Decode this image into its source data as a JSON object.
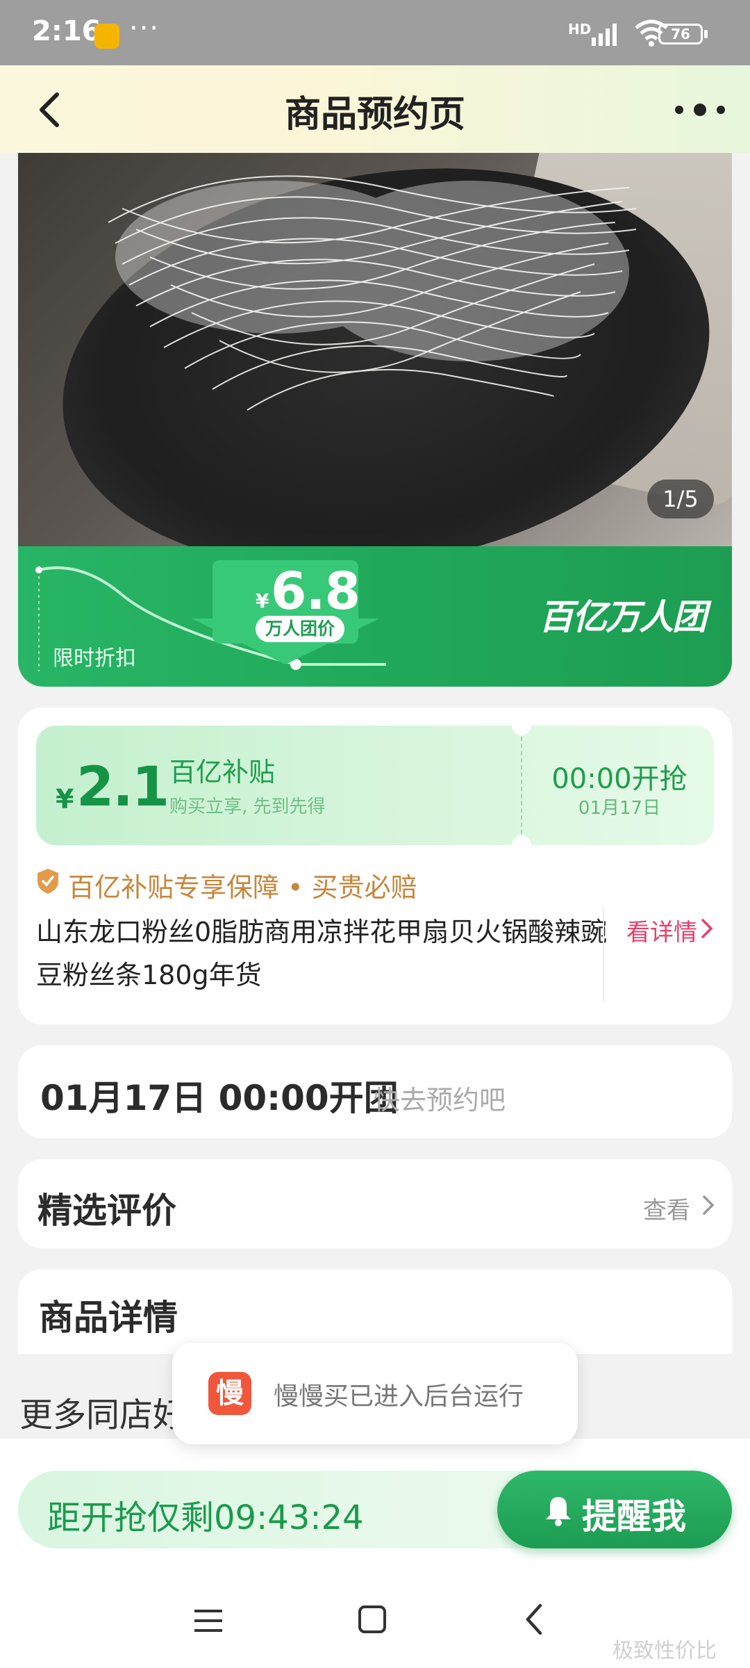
{
  "status_bar": {
    "time": "2:16",
    "more": "···",
    "network": "HD",
    "battery": "76"
  },
  "header": {
    "title": "商品预约页"
  },
  "hero": {
    "image_counter": "1/5"
  },
  "price_band": {
    "currency": "¥",
    "price": "6.8",
    "price_tag": "万人团价",
    "limited_label": "限时折扣",
    "brand": "百亿万人团"
  },
  "subsidy": {
    "currency": "¥",
    "amount": "2.1",
    "name": "百亿补贴",
    "subtitle": "购买立享, 先到先得",
    "start_time": "00:00开抢",
    "start_date": "01月17日"
  },
  "guarantee": {
    "text": "百亿补贴专享保障 • 买贵必赔"
  },
  "product": {
    "title": "山东龙口粉丝0脂肪商用凉拌花甲扇贝火锅酸辣豌豆粉丝条180g年货",
    "see_details": "看详情"
  },
  "group_open": {
    "datetime": "01月17日 00:00开团",
    "hint": "快去预约吧"
  },
  "reviews": {
    "title": "精选评价",
    "view": "查看"
  },
  "details": {
    "title": "商品详情"
  },
  "more_shop": {
    "title": "更多同店好"
  },
  "toast": {
    "icon_char": "慢",
    "message": "慢慢买已进入后台运行"
  },
  "bottom": {
    "countdown": "距开抢仅剩09:43:24",
    "remind_label": "提醒我"
  },
  "watermark": "极致性价比",
  "colors": {
    "brand_green": "#1f9c52",
    "accent_red": "#e6406a",
    "guarantee_orange": "#c7863c"
  }
}
